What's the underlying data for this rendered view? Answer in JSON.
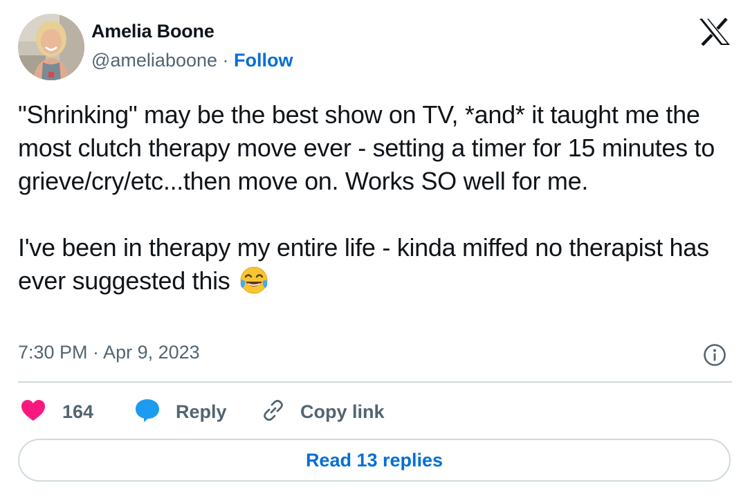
{
  "author": {
    "name": "Amelia Boone",
    "handle": "@ameliaboone",
    "separator": " · ",
    "follow_label": "Follow"
  },
  "tweet": {
    "text": "\"Shrinking\" may be the best show on TV, *and* it taught me the most clutch therapy move ever - setting a timer for 15 minutes to grieve/cry/etc...then move on. Works SO well for me.\n\nI've been in therapy my entire life - kinda miffed no therapist has ever suggested this",
    "emoji": "face-with-tears-of-joy"
  },
  "meta": {
    "timestamp": "7:30 PM · Apr 9, 2023"
  },
  "actions": {
    "like_count": "164",
    "reply_label": "Reply",
    "copy_link_label": "Copy link"
  },
  "footer": {
    "read_replies_label": "Read 13 replies"
  },
  "colors": {
    "link_blue": "#006fd6",
    "heart_pink": "#f91880",
    "reply_blue": "#1d9bf0",
    "secondary_text": "#536471",
    "divider": "#cfd9de"
  },
  "icons": [
    "x-logo-icon",
    "info-icon",
    "heart-icon",
    "reply-bubble-icon",
    "link-icon"
  ]
}
